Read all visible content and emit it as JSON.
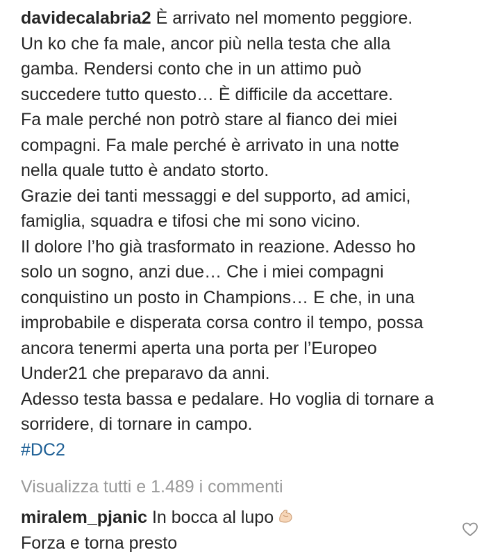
{
  "post": {
    "author": "davidecalabria2",
    "caption_lines": [
      " È arrivato nel momento peggiore.",
      "Un ko che fa male, ancor più nella testa che alla",
      "gamba. Rendersi conto che in un attimo può",
      "succedere tutto questo… È difficile da accettare.",
      "Fa male perché non potrò stare al fianco dei miei",
      "compagni. Fa male perché è arrivato in una notte",
      "nella quale tutto è andato storto.",
      "Grazie dei tanti messaggi e del supporto, ad amici,",
      "famiglia, squadra e tifosi che mi sono vicino.",
      "Il dolore l’ho già trasformato in reazione. Adesso ho",
      "solo un sogno, anzi due… Che i miei compagni",
      "conquistino un posto in Champions… E che, in una",
      "improbabile e disperata corsa contro il tempo, possa",
      "ancora tenermi aperta una porta per l’Europeo",
      "Under21 che preparavo da anni.",
      "Adesso testa bassa e pedalare. Ho voglia di tornare a",
      "sorridere, di tornare in campo."
    ],
    "hashtag": "#DC2"
  },
  "comments_link": "Visualizza tutti e 1.489 i commenti",
  "comment": {
    "author": "miralem_pjanic",
    "text_line1": " In bocca al lupo",
    "text_line2": "Forza e torna presto",
    "emoji": "flexed-biceps-icon"
  },
  "colors": {
    "text": "#262626",
    "hashtag": "#1d5f95",
    "muted": "#999999"
  }
}
